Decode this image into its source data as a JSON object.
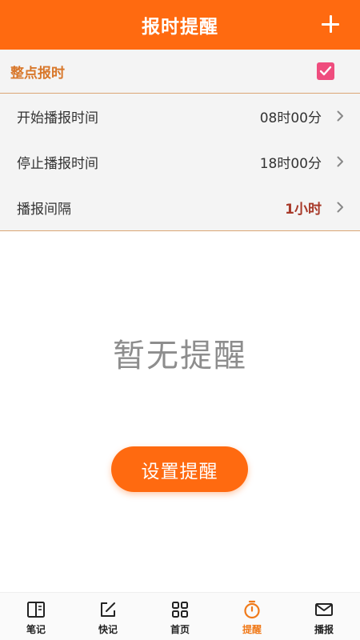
{
  "header": {
    "title": "报时提醒",
    "add_icon": "plus-icon"
  },
  "hourly": {
    "label": "整点报时",
    "checked": true
  },
  "settings": [
    {
      "label": "开始播报时间",
      "value": "08时00分"
    },
    {
      "label": "停止播报时间",
      "value": "18时00分"
    },
    {
      "label": "播报间隔",
      "value": "1小时"
    }
  ],
  "empty": {
    "message": "暂无提醒",
    "button_label": "设置提醒"
  },
  "nav": {
    "items": [
      {
        "label": "笔记",
        "icon": "notebook-icon"
      },
      {
        "label": "快记",
        "icon": "edit-icon"
      },
      {
        "label": "首页",
        "icon": "home-grid-icon"
      },
      {
        "label": "提醒",
        "icon": "timer-icon",
        "active": true
      },
      {
        "label": "播报",
        "icon": "mail-icon"
      }
    ]
  },
  "colors": {
    "accent": "#ff6a10",
    "checkbox": "#ef4d7e",
    "interval_value": "#a83a2a",
    "divider": "#dba675"
  }
}
